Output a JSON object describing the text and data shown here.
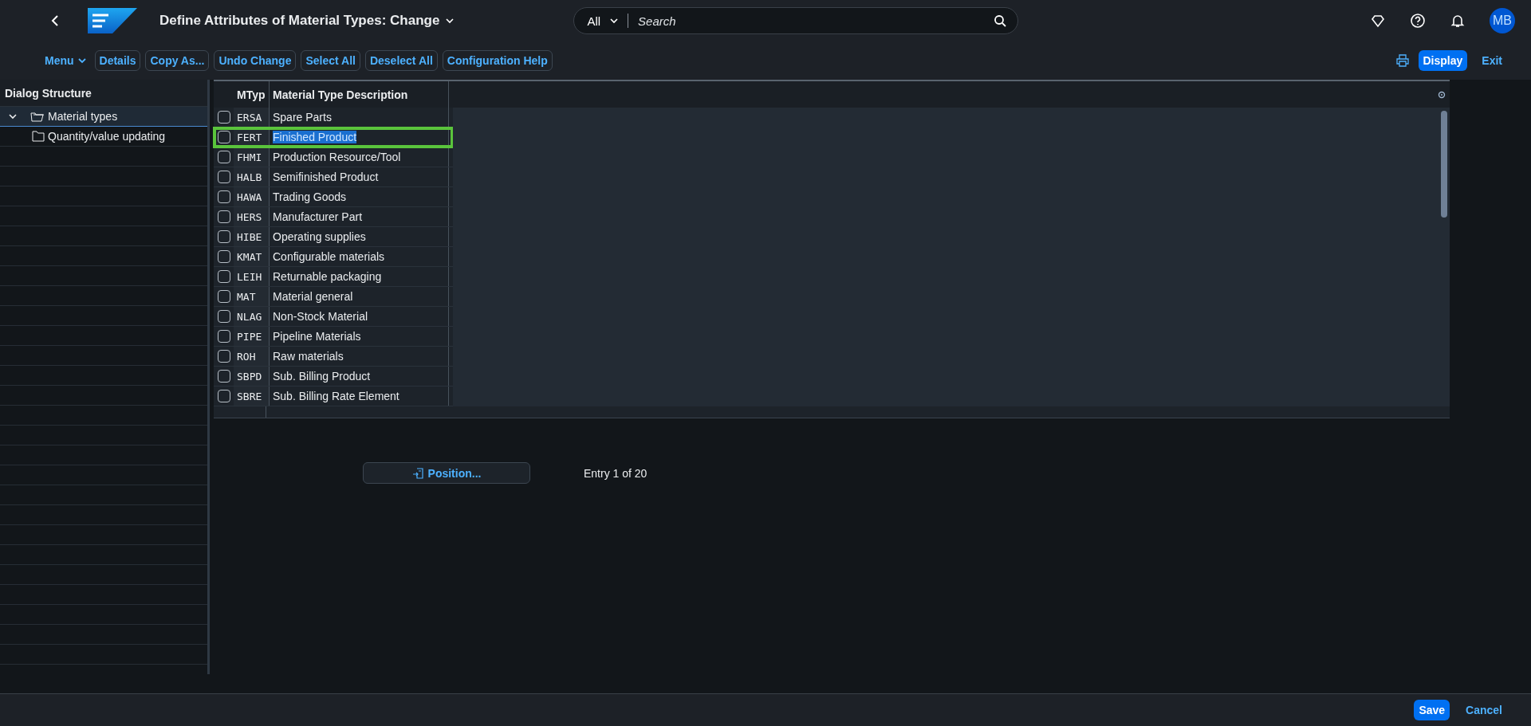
{
  "shell": {
    "title": "Define Attributes of Material Types: Change",
    "search_scope": "All",
    "search_placeholder": "Search",
    "avatar": "MB"
  },
  "toolbar": {
    "menu": "Menu",
    "buttons": [
      "Details",
      "Copy As...",
      "Undo Change",
      "Select All",
      "Deselect All",
      "Configuration Help"
    ],
    "display": "Display",
    "exit": "Exit"
  },
  "dialog_structure": {
    "title": "Dialog Structure",
    "items": [
      {
        "label": "Material types",
        "expanded": true,
        "selected": true,
        "children": [
          {
            "label": "Quantity/value updating",
            "selected": false
          }
        ]
      }
    ]
  },
  "table": {
    "columns": [
      "MTyp",
      "Material Type Description"
    ],
    "rows": [
      {
        "code": "ERSA",
        "description": "Spare Parts",
        "checked": false,
        "selected": false
      },
      {
        "code": "FERT",
        "description": "Finished Product",
        "checked": false,
        "selected": true
      },
      {
        "code": "FHMI",
        "description": "Production Resource/Tool",
        "checked": false,
        "selected": false
      },
      {
        "code": "HALB",
        "description": "Semifinished Product",
        "checked": false,
        "selected": false
      },
      {
        "code": "HAWA",
        "description": "Trading Goods",
        "checked": false,
        "selected": false
      },
      {
        "code": "HERS",
        "description": "Manufacturer Part",
        "checked": false,
        "selected": false
      },
      {
        "code": "HIBE",
        "description": "Operating supplies",
        "checked": false,
        "selected": false
      },
      {
        "code": "KMAT",
        "description": "Configurable materials",
        "checked": false,
        "selected": false
      },
      {
        "code": "LEIH",
        "description": "Returnable packaging",
        "checked": false,
        "selected": false
      },
      {
        "code": "MAT",
        "description": "Material general",
        "checked": false,
        "selected": false
      },
      {
        "code": "NLAG",
        "description": "Non-Stock Material",
        "checked": false,
        "selected": false
      },
      {
        "code": "PIPE",
        "description": "Pipeline Materials",
        "checked": false,
        "selected": false
      },
      {
        "code": "ROH",
        "description": "Raw materials",
        "checked": false,
        "selected": false
      },
      {
        "code": "SBPD",
        "description": "Sub. Billing Product",
        "checked": false,
        "selected": false
      },
      {
        "code": "SBRE",
        "description": "Sub. Billing Rate Element",
        "checked": false,
        "selected": false
      }
    ]
  },
  "position_button": "Position...",
  "entry_info": "Entry 1 of 20",
  "footer": {
    "save": "Save",
    "cancel": "Cancel"
  }
}
